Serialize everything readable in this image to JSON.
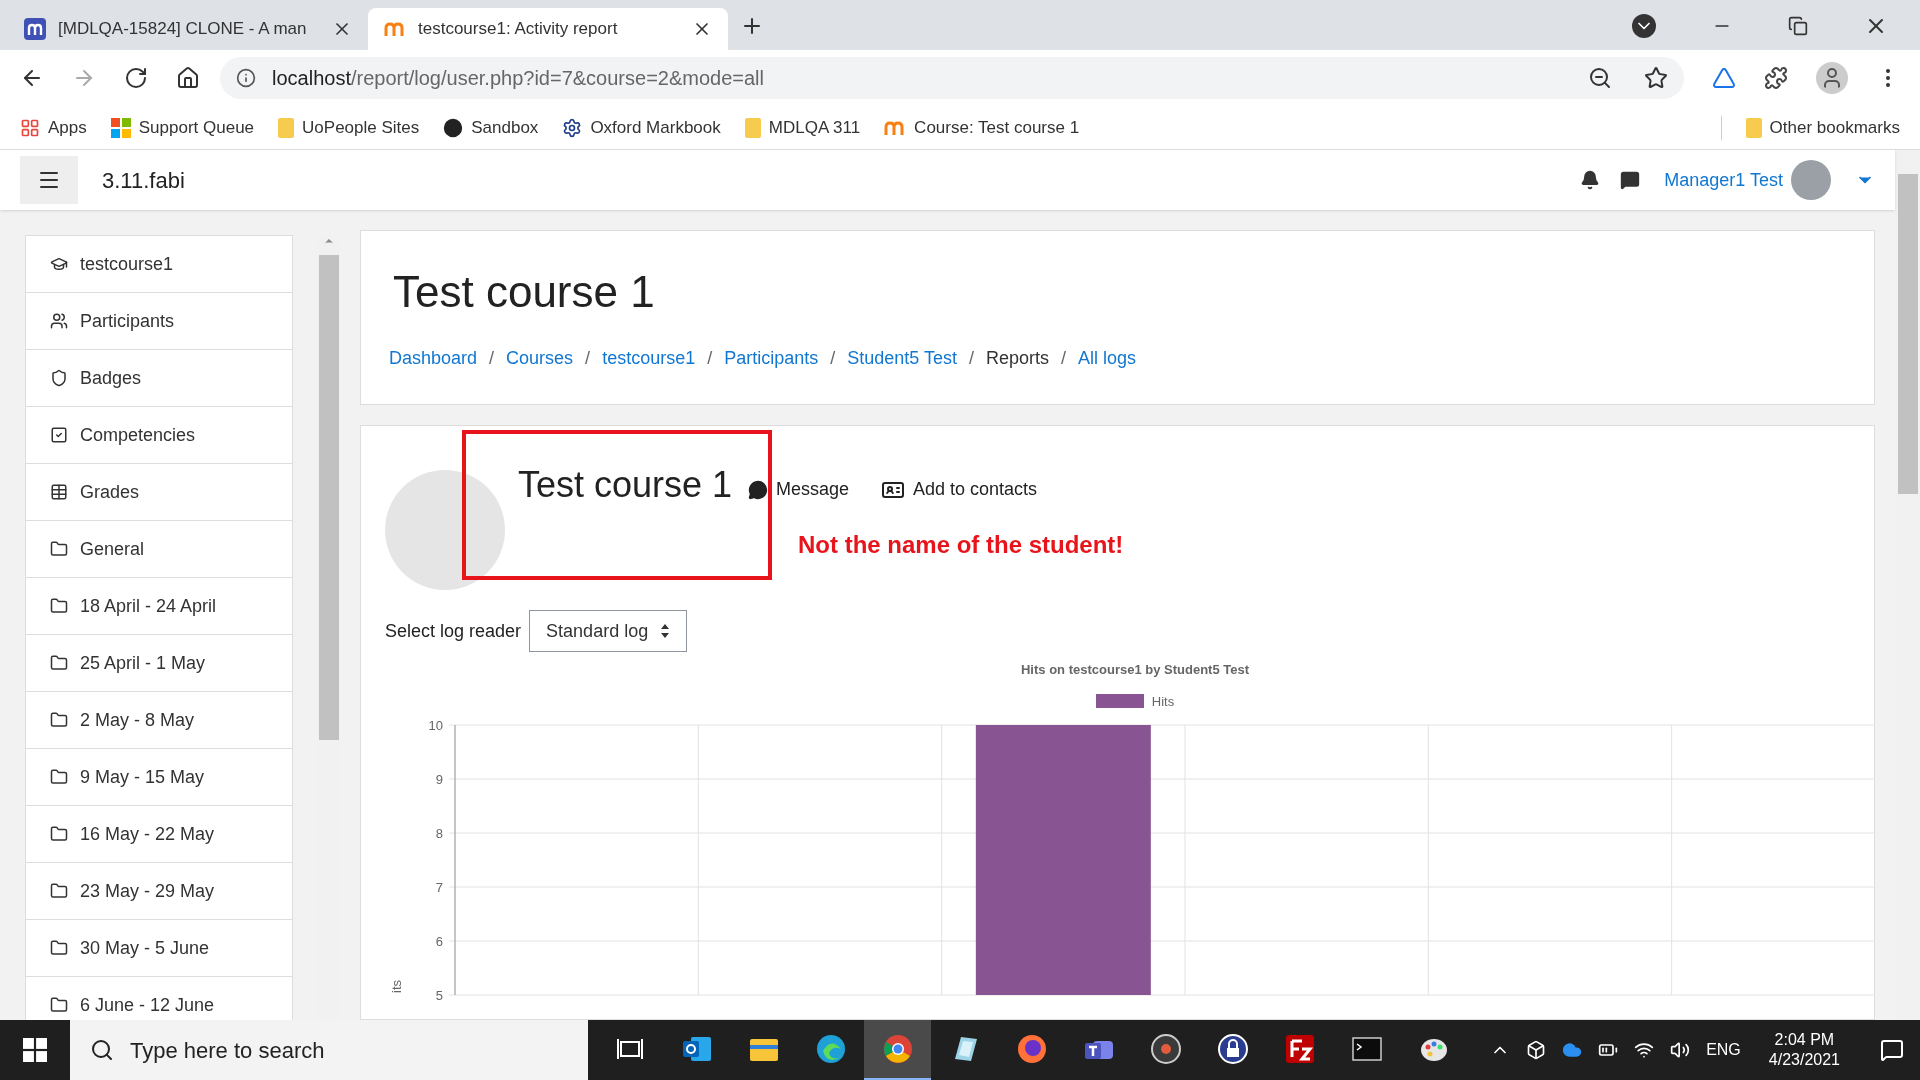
{
  "browser": {
    "tabs": [
      {
        "title": "[MDLQA-15824] CLONE - A man",
        "kind": "jira",
        "selected": false
      },
      {
        "title": "testcourse1: Activity report",
        "kind": "moodle",
        "selected": true
      }
    ],
    "address": {
      "host": "localhost",
      "path": "/report/log/user.php?id=7&course=2&mode=all"
    },
    "bookmarks": [
      {
        "label": "Apps",
        "kind": "grid"
      },
      {
        "label": "Support Queue",
        "kind": "windows"
      },
      {
        "label": "UoPeople Sites",
        "kind": "folder"
      },
      {
        "label": "Sandbox",
        "kind": "circle"
      },
      {
        "label": "Oxford Markbook",
        "kind": "gear"
      },
      {
        "label": "MDLQA 311",
        "kind": "folder"
      },
      {
        "label": "Course: Test course 1",
        "kind": "moodle"
      }
    ],
    "other_bookmarks": "Other bookmarks"
  },
  "navbar": {
    "site_name": "3.11.fabi",
    "user": "Manager1 Test"
  },
  "sidebar": {
    "items": [
      {
        "label": "testcourse1",
        "kind": "cap"
      },
      {
        "label": "Participants",
        "kind": "users"
      },
      {
        "label": "Badges",
        "kind": "shield"
      },
      {
        "label": "Competencies",
        "kind": "check"
      },
      {
        "label": "Grades",
        "kind": "table"
      },
      {
        "label": "General",
        "kind": "folder"
      },
      {
        "label": "18 April - 24 April",
        "kind": "folder"
      },
      {
        "label": "25 April - 1 May",
        "kind": "folder"
      },
      {
        "label": "2 May - 8 May",
        "kind": "folder"
      },
      {
        "label": "9 May - 15 May",
        "kind": "folder"
      },
      {
        "label": "16 May - 22 May",
        "kind": "folder"
      },
      {
        "label": "23 May - 29 May",
        "kind": "folder"
      },
      {
        "label": "30 May - 5 June",
        "kind": "folder"
      },
      {
        "label": "6 June - 12 June",
        "kind": "folder"
      }
    ]
  },
  "header": {
    "title": "Test course 1",
    "breadcrumb": [
      {
        "label": "Dashboard",
        "link": true
      },
      {
        "label": "Courses",
        "link": true,
        "separator": "/"
      },
      {
        "label": "testcourse1",
        "link": true,
        "separator": "/"
      },
      {
        "label": "Participants",
        "link": true,
        "separator": "/"
      },
      {
        "label": "Student5 Test",
        "link": true,
        "separator": "/"
      },
      {
        "label": "Reports",
        "link": false,
        "separator": "/"
      },
      {
        "label": "All logs",
        "link": true,
        "separator": "/"
      }
    ]
  },
  "profile": {
    "name": "Test course 1",
    "message": "Message",
    "add_contact": "Add to contacts",
    "annotation": "Not the name of the student!"
  },
  "log_reader": {
    "label": "Select log reader",
    "value": "Standard log"
  },
  "chart_data": {
    "type": "bar",
    "title": "Hits on testcourse1 by Student5 Test",
    "ylabel": "its",
    "series": [
      {
        "name": "Hits",
        "color": "#885592",
        "values": [
          null,
          null,
          10,
          null,
          null,
          null
        ]
      }
    ],
    "ylim": [
      5,
      10
    ],
    "yticks": [
      5,
      6,
      7,
      8,
      9,
      10
    ],
    "grid": true
  },
  "taskbar": {
    "search_placeholder": "Type here to search",
    "apps": [
      {
        "kind": "taskview",
        "selected": false
      },
      {
        "kind": "outlook",
        "selected": false
      },
      {
        "kind": "explorer",
        "selected": false
      },
      {
        "kind": "edge",
        "selected": false
      },
      {
        "kind": "chrome",
        "selected": true
      },
      {
        "kind": "notepad",
        "selected": false
      },
      {
        "kind": "firefox",
        "selected": false
      },
      {
        "kind": "teams",
        "selected": false
      },
      {
        "kind": "disc",
        "selected": false
      },
      {
        "kind": "lock",
        "selected": false
      },
      {
        "kind": "filezilla",
        "selected": false
      },
      {
        "kind": "terminal",
        "selected": false
      },
      {
        "kind": "paint",
        "selected": false
      }
    ],
    "language": "ENG",
    "time": "2:04 PM",
    "date": "4/23/2021"
  }
}
